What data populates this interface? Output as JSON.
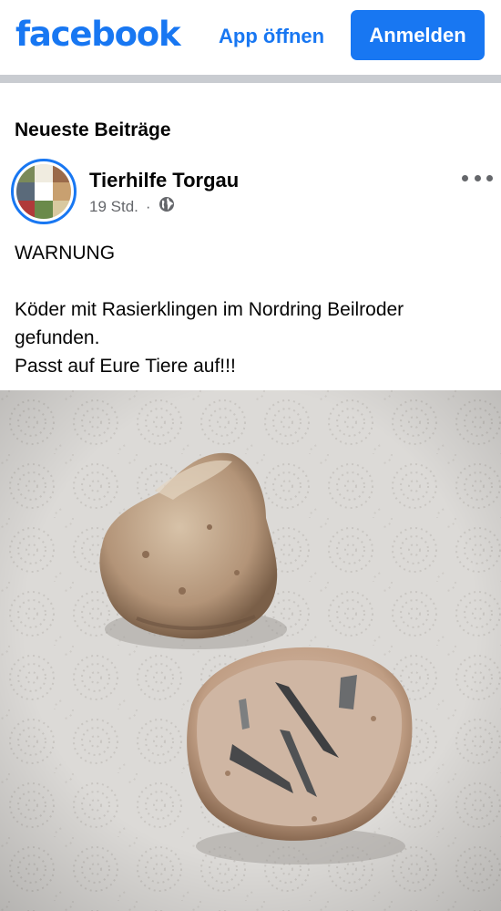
{
  "header": {
    "logo_text": "facebook",
    "open_app_label": "App öffnen",
    "login_label": "Anmelden",
    "brand_color": "#1877f2"
  },
  "feed": {
    "section_title": "Neueste Beiträge"
  },
  "post": {
    "page_name": "Tierhilfe Torgau",
    "time": "19 Std.",
    "separator": "·",
    "audience_icon": "globe-icon",
    "more_icon": "more-options-icon",
    "text_lines": [
      "WARNUNG",
      "",
      "Köder mit Rasierklingen im Nordring Beilroder gefunden.",
      "Passt auf Eure Tiere auf!!!"
    ]
  }
}
